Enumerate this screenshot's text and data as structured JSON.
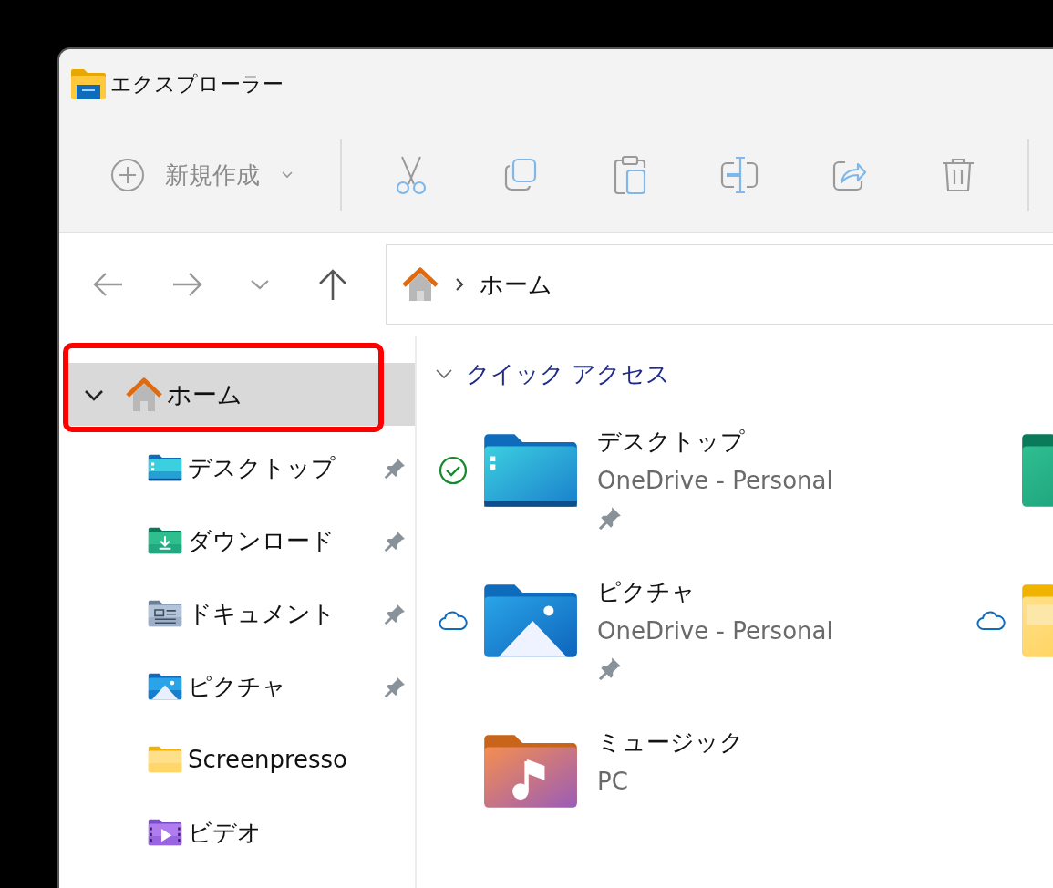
{
  "window": {
    "title": "エクスプローラー"
  },
  "toolbar": {
    "new_button": {
      "label": "新規作成"
    }
  },
  "address_bar": {
    "path": [
      "ホーム"
    ]
  },
  "sidebar": {
    "items": [
      {
        "label": "ホーム",
        "kind": "home",
        "expanded": true,
        "selected": true,
        "children": [
          {
            "label": "デスクトップ",
            "kind": "desktop",
            "pinned": true
          },
          {
            "label": "ダウンロード",
            "kind": "downloads",
            "pinned": true
          },
          {
            "label": "ドキュメント",
            "kind": "documents",
            "pinned": true
          },
          {
            "label": "ピクチャ",
            "kind": "pictures",
            "pinned": true
          },
          {
            "label": "Screenpresso",
            "kind": "folder",
            "pinned": false
          },
          {
            "label": "ビデオ",
            "kind": "videos",
            "pinned": false
          }
        ]
      }
    ]
  },
  "quick_access": {
    "title": "クイック アクセス",
    "expanded": true,
    "items": [
      {
        "name": "デスクトップ",
        "location": "OneDrive - Personal",
        "kind": "desktop",
        "synced": true,
        "online_only": false,
        "pinned": true
      },
      {
        "kind": "downloads",
        "synced": false,
        "online_only": false,
        "pinned": false
      },
      {
        "name": "ピクチャ",
        "location": "OneDrive - Personal",
        "kind": "pictures",
        "synced": false,
        "online_only": true,
        "pinned": true
      },
      {
        "kind": "folder",
        "synced": false,
        "online_only": true,
        "pinned": false
      },
      {
        "name": "ミュージック",
        "location": "PC",
        "kind": "music",
        "synced": false,
        "online_only": false,
        "pinned": false
      }
    ]
  }
}
